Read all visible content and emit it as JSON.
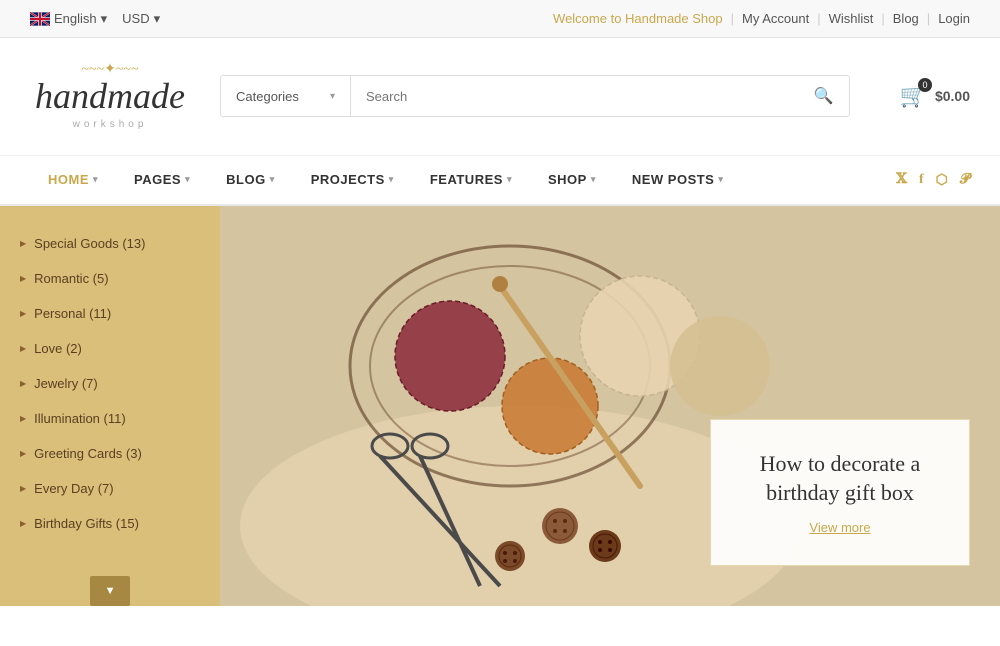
{
  "topbar": {
    "language": "English",
    "currency": "USD",
    "welcome": "Welcome to Handmade Shop",
    "links": [
      {
        "label": "My Account",
        "id": "my-account"
      },
      {
        "label": "Wishlist",
        "id": "wishlist"
      },
      {
        "label": "Blog",
        "id": "blog-top"
      },
      {
        "label": "Login",
        "id": "login"
      }
    ]
  },
  "logo": {
    "script": "handmade",
    "subtitle": "workshop",
    "swirl": "~~~"
  },
  "search": {
    "categories_label": "Categories",
    "placeholder": "Search",
    "button_icon": "🔍"
  },
  "cart": {
    "badge": "0",
    "amount": "$0.00"
  },
  "nav": {
    "items": [
      {
        "label": "HOME",
        "active": true,
        "has_arrow": true
      },
      {
        "label": "PAGES",
        "active": false,
        "has_arrow": true
      },
      {
        "label": "BLOG",
        "active": false,
        "has_arrow": true
      },
      {
        "label": "PROJECTS",
        "active": false,
        "has_arrow": true
      },
      {
        "label": "FEATURES",
        "active": false,
        "has_arrow": true
      },
      {
        "label": "SHOP",
        "active": false,
        "has_arrow": true
      },
      {
        "label": "NEW POSTS",
        "active": false,
        "has_arrow": true
      }
    ],
    "social": [
      {
        "icon": "twitter",
        "symbol": "𝕏"
      },
      {
        "icon": "facebook",
        "symbol": "f"
      },
      {
        "icon": "vimeo",
        "symbol": "v"
      },
      {
        "icon": "pinterest",
        "symbol": "p"
      }
    ]
  },
  "sidebar": {
    "items": [
      {
        "label": "Special Goods (13)"
      },
      {
        "label": "Romantic (5)"
      },
      {
        "label": "Personal (11)"
      },
      {
        "label": "Love (2)"
      },
      {
        "label": "Jewelry (7)"
      },
      {
        "label": "Illumination (11)"
      },
      {
        "label": "Greeting Cards (3)"
      },
      {
        "label": "Every Day (7)"
      },
      {
        "label": "Birthday Gifts (15)"
      }
    ],
    "expand_icon": "▼"
  },
  "hero_card": {
    "title": "How to decorate a birthday gift box",
    "link": "View more"
  }
}
